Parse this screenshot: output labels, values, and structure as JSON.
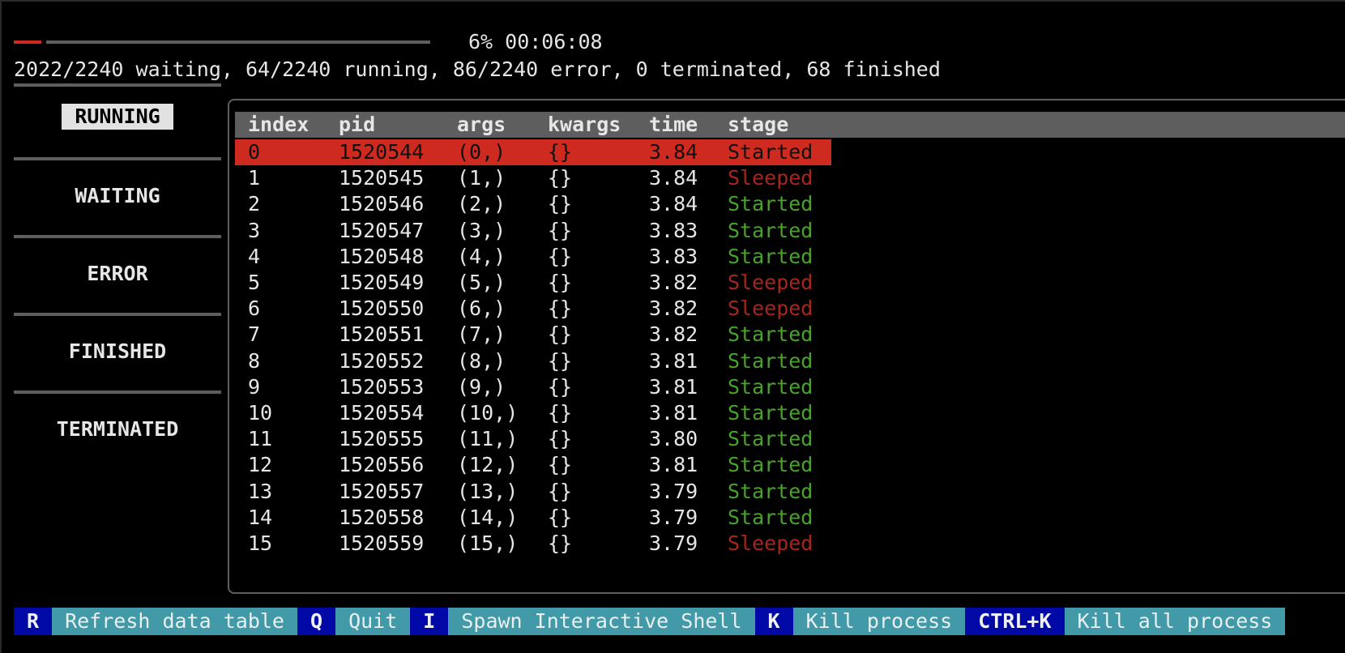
{
  "progress": {
    "percent": 6,
    "label": "6% 00:06:08"
  },
  "summary": "2022/2240 waiting, 64/2240 running, 86/2240 error, 0 terminated, 68 finished",
  "sidebar": {
    "items": [
      {
        "label": "RUNNING",
        "active": true
      },
      {
        "label": "WAITING",
        "active": false
      },
      {
        "label": "ERROR",
        "active": false
      },
      {
        "label": "FINISHED",
        "active": false
      },
      {
        "label": "TERMINATED",
        "active": false
      }
    ]
  },
  "table": {
    "columns": [
      "index",
      "pid",
      "args",
      "kwargs",
      "time",
      "stage"
    ],
    "rows": [
      {
        "index": "0",
        "pid": "1520544",
        "args": "(0,)",
        "kwargs": "{}",
        "time": "3.84",
        "stage": "Started"
      },
      {
        "index": "1",
        "pid": "1520545",
        "args": "(1,)",
        "kwargs": "{}",
        "time": "3.84",
        "stage": "Sleeped"
      },
      {
        "index": "2",
        "pid": "1520546",
        "args": "(2,)",
        "kwargs": "{}",
        "time": "3.84",
        "stage": "Started"
      },
      {
        "index": "3",
        "pid": "1520547",
        "args": "(3,)",
        "kwargs": "{}",
        "time": "3.83",
        "stage": "Started"
      },
      {
        "index": "4",
        "pid": "1520548",
        "args": "(4,)",
        "kwargs": "{}",
        "time": "3.83",
        "stage": "Started"
      },
      {
        "index": "5",
        "pid": "1520549",
        "args": "(5,)",
        "kwargs": "{}",
        "time": "3.82",
        "stage": "Sleeped"
      },
      {
        "index": "6",
        "pid": "1520550",
        "args": "(6,)",
        "kwargs": "{}",
        "time": "3.82",
        "stage": "Sleeped"
      },
      {
        "index": "7",
        "pid": "1520551",
        "args": "(7,)",
        "kwargs": "{}",
        "time": "3.82",
        "stage": "Started"
      },
      {
        "index": "8",
        "pid": "1520552",
        "args": "(8,)",
        "kwargs": "{}",
        "time": "3.81",
        "stage": "Started"
      },
      {
        "index": "9",
        "pid": "1520553",
        "args": "(9,)",
        "kwargs": "{}",
        "time": "3.81",
        "stage": "Started"
      },
      {
        "index": "10",
        "pid": "1520554",
        "args": "(10,)",
        "kwargs": "{}",
        "time": "3.81",
        "stage": "Started"
      },
      {
        "index": "11",
        "pid": "1520555",
        "args": "(11,)",
        "kwargs": "{}",
        "time": "3.80",
        "stage": "Started"
      },
      {
        "index": "12",
        "pid": "1520556",
        "args": "(12,)",
        "kwargs": "{}",
        "time": "3.81",
        "stage": "Started"
      },
      {
        "index": "13",
        "pid": "1520557",
        "args": "(13,)",
        "kwargs": "{}",
        "time": "3.79",
        "stage": "Started"
      },
      {
        "index": "14",
        "pid": "1520558",
        "args": "(14,)",
        "kwargs": "{}",
        "time": "3.79",
        "stage": "Started"
      },
      {
        "index": "15",
        "pid": "1520559",
        "args": "(15,)",
        "kwargs": "{}",
        "time": "3.79",
        "stage": "Sleeped"
      }
    ],
    "selected_row": 0
  },
  "footer": {
    "bindings": [
      {
        "key": "R",
        "label": "Refresh data table"
      },
      {
        "key": "Q",
        "label": "Quit"
      },
      {
        "key": "I",
        "label": "Spawn Interactive Shell"
      },
      {
        "key": "K",
        "label": "Kill process"
      },
      {
        "key": "CTRL+K",
        "label": "Kill all process"
      }
    ]
  },
  "colors": {
    "accent_red": "#cf2a1f",
    "started_green": "#4aa22e",
    "sleeped_red": "#a6261d",
    "key_blue": "#0008a6",
    "footer_teal": "#4299a8",
    "header_gray": "#5e5e5e"
  }
}
